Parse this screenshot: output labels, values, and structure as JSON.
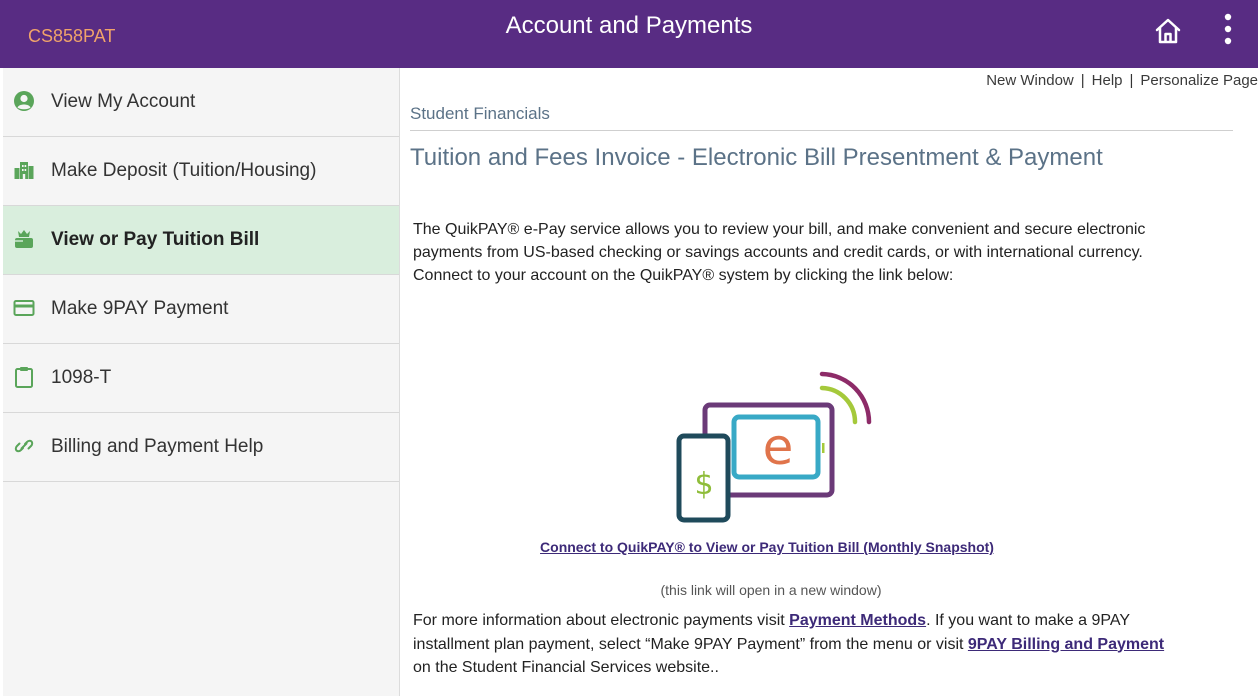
{
  "header": {
    "user_id": "CS858PAT",
    "title": "Account and Payments",
    "colors": {
      "bar": "#582c83",
      "user_id": "#f0a36a"
    }
  },
  "sidebar": {
    "items": [
      {
        "label": "View My Account",
        "icon": "user-circle-icon",
        "active": false
      },
      {
        "label": "Make Deposit (Tuition/Housing)",
        "icon": "building-icon",
        "active": false
      },
      {
        "label": "View or Pay Tuition Bill",
        "icon": "cash-hand-icon",
        "active": true
      },
      {
        "label": "Make 9PAY Payment",
        "icon": "credit-card-icon",
        "active": false
      },
      {
        "label": "1098-T",
        "icon": "clipboard-icon",
        "active": false
      },
      {
        "label": "Billing and Payment Help",
        "icon": "link-icon",
        "active": false
      }
    ],
    "colors": {
      "icon": "#5aa55a",
      "active_bg": "#d9eedd"
    }
  },
  "top_links": {
    "new_window": "New Window",
    "help": "Help",
    "personalize": "Personalize Page",
    "separator": "|"
  },
  "main": {
    "breadcrumb": "Student Financials",
    "page_title": "Tuition and Fees Invoice - Electronic Bill Presentment & Payment",
    "intro": "The QuikPAY® e-Pay service allows you to review your bill, and make convenient and secure electronic payments from US-based checking or savings accounts and credit cards, or with international currency. Connect to your account on the QuikPAY® system by clicking the link below:",
    "connect_link": "Connect to QuikPAY® to View or Pay Tuition Bill (Monthly Snapshot)",
    "new_window_note": "(this link will open in a new window)",
    "more_info": {
      "text_1": "For more information about electronic payments visit ",
      "link_1": "Payment Methods",
      "text_2": ". If you want to make a 9PAY installment plan payment, select “Make 9PAY Payment” from the menu or visit ",
      "link_2": "9PAY Billing and Payment",
      "text_3": " on the Student Financial Services website.."
    },
    "graphic": {
      "dollar": "$",
      "e": "e",
      "icon": "quikpay-illustration-icon"
    }
  }
}
